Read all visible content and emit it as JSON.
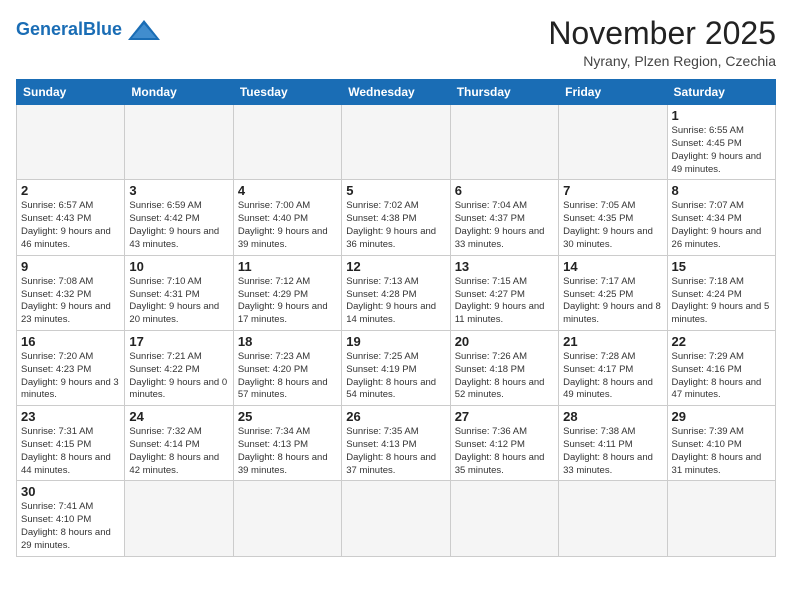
{
  "logo": {
    "general": "General",
    "blue": "Blue"
  },
  "header": {
    "month": "November 2025",
    "location": "Nyrany, Plzen Region, Czechia"
  },
  "weekdays": [
    "Sunday",
    "Monday",
    "Tuesday",
    "Wednesday",
    "Thursday",
    "Friday",
    "Saturday"
  ],
  "weeks": [
    [
      {
        "day": "",
        "info": ""
      },
      {
        "day": "",
        "info": ""
      },
      {
        "day": "",
        "info": ""
      },
      {
        "day": "",
        "info": ""
      },
      {
        "day": "",
        "info": ""
      },
      {
        "day": "",
        "info": ""
      },
      {
        "day": "1",
        "info": "Sunrise: 6:55 AM\nSunset: 4:45 PM\nDaylight: 9 hours and 49 minutes."
      }
    ],
    [
      {
        "day": "2",
        "info": "Sunrise: 6:57 AM\nSunset: 4:43 PM\nDaylight: 9 hours and 46 minutes."
      },
      {
        "day": "3",
        "info": "Sunrise: 6:59 AM\nSunset: 4:42 PM\nDaylight: 9 hours and 43 minutes."
      },
      {
        "day": "4",
        "info": "Sunrise: 7:00 AM\nSunset: 4:40 PM\nDaylight: 9 hours and 39 minutes."
      },
      {
        "day": "5",
        "info": "Sunrise: 7:02 AM\nSunset: 4:38 PM\nDaylight: 9 hours and 36 minutes."
      },
      {
        "day": "6",
        "info": "Sunrise: 7:04 AM\nSunset: 4:37 PM\nDaylight: 9 hours and 33 minutes."
      },
      {
        "day": "7",
        "info": "Sunrise: 7:05 AM\nSunset: 4:35 PM\nDaylight: 9 hours and 30 minutes."
      },
      {
        "day": "8",
        "info": "Sunrise: 7:07 AM\nSunset: 4:34 PM\nDaylight: 9 hours and 26 minutes."
      }
    ],
    [
      {
        "day": "9",
        "info": "Sunrise: 7:08 AM\nSunset: 4:32 PM\nDaylight: 9 hours and 23 minutes."
      },
      {
        "day": "10",
        "info": "Sunrise: 7:10 AM\nSunset: 4:31 PM\nDaylight: 9 hours and 20 minutes."
      },
      {
        "day": "11",
        "info": "Sunrise: 7:12 AM\nSunset: 4:29 PM\nDaylight: 9 hours and 17 minutes."
      },
      {
        "day": "12",
        "info": "Sunrise: 7:13 AM\nSunset: 4:28 PM\nDaylight: 9 hours and 14 minutes."
      },
      {
        "day": "13",
        "info": "Sunrise: 7:15 AM\nSunset: 4:27 PM\nDaylight: 9 hours and 11 minutes."
      },
      {
        "day": "14",
        "info": "Sunrise: 7:17 AM\nSunset: 4:25 PM\nDaylight: 9 hours and 8 minutes."
      },
      {
        "day": "15",
        "info": "Sunrise: 7:18 AM\nSunset: 4:24 PM\nDaylight: 9 hours and 5 minutes."
      }
    ],
    [
      {
        "day": "16",
        "info": "Sunrise: 7:20 AM\nSunset: 4:23 PM\nDaylight: 9 hours and 3 minutes."
      },
      {
        "day": "17",
        "info": "Sunrise: 7:21 AM\nSunset: 4:22 PM\nDaylight: 9 hours and 0 minutes."
      },
      {
        "day": "18",
        "info": "Sunrise: 7:23 AM\nSunset: 4:20 PM\nDaylight: 8 hours and 57 minutes."
      },
      {
        "day": "19",
        "info": "Sunrise: 7:25 AM\nSunset: 4:19 PM\nDaylight: 8 hours and 54 minutes."
      },
      {
        "day": "20",
        "info": "Sunrise: 7:26 AM\nSunset: 4:18 PM\nDaylight: 8 hours and 52 minutes."
      },
      {
        "day": "21",
        "info": "Sunrise: 7:28 AM\nSunset: 4:17 PM\nDaylight: 8 hours and 49 minutes."
      },
      {
        "day": "22",
        "info": "Sunrise: 7:29 AM\nSunset: 4:16 PM\nDaylight: 8 hours and 47 minutes."
      }
    ],
    [
      {
        "day": "23",
        "info": "Sunrise: 7:31 AM\nSunset: 4:15 PM\nDaylight: 8 hours and 44 minutes."
      },
      {
        "day": "24",
        "info": "Sunrise: 7:32 AM\nSunset: 4:14 PM\nDaylight: 8 hours and 42 minutes."
      },
      {
        "day": "25",
        "info": "Sunrise: 7:34 AM\nSunset: 4:13 PM\nDaylight: 8 hours and 39 minutes."
      },
      {
        "day": "26",
        "info": "Sunrise: 7:35 AM\nSunset: 4:13 PM\nDaylight: 8 hours and 37 minutes."
      },
      {
        "day": "27",
        "info": "Sunrise: 7:36 AM\nSunset: 4:12 PM\nDaylight: 8 hours and 35 minutes."
      },
      {
        "day": "28",
        "info": "Sunrise: 7:38 AM\nSunset: 4:11 PM\nDaylight: 8 hours and 33 minutes."
      },
      {
        "day": "29",
        "info": "Sunrise: 7:39 AM\nSunset: 4:10 PM\nDaylight: 8 hours and 31 minutes."
      }
    ],
    [
      {
        "day": "30",
        "info": "Sunrise: 7:41 AM\nSunset: 4:10 PM\nDaylight: 8 hours and 29 minutes."
      },
      {
        "day": "",
        "info": ""
      },
      {
        "day": "",
        "info": ""
      },
      {
        "day": "",
        "info": ""
      },
      {
        "day": "",
        "info": ""
      },
      {
        "day": "",
        "info": ""
      },
      {
        "day": "",
        "info": ""
      }
    ]
  ]
}
